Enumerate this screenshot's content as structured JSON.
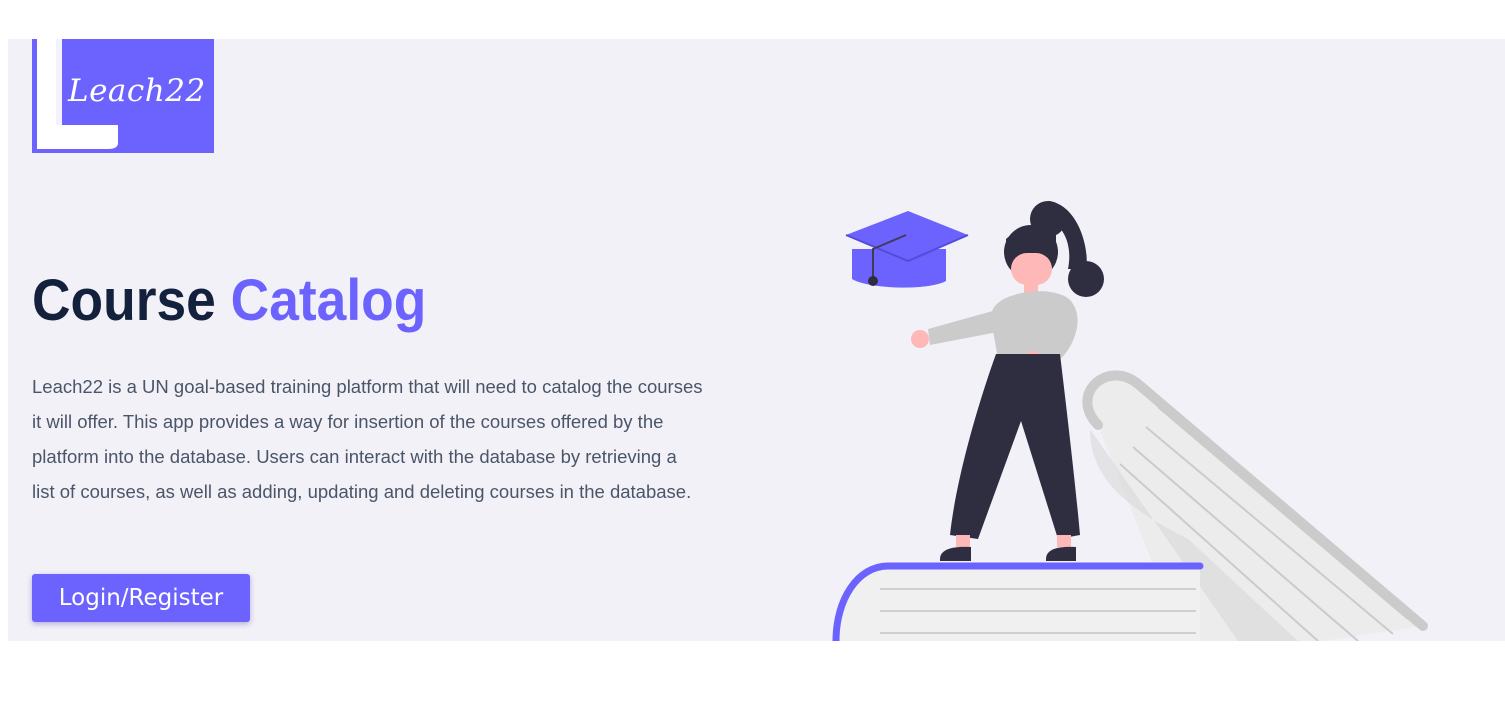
{
  "brand": {
    "logo_text": "Leach22",
    "logo_color": "#6c63ff"
  },
  "hero": {
    "title_main": "Course",
    "title_accent": "Catalog",
    "description": "Leach22 is a UN goal-based training platform that will need to catalog the courses it will offer. This app provides a way for insertion of the courses offered by the platform into the database. Users can interact with the database by retrieving a list of courses, as well as adding, updating and deleting courses in the database.",
    "cta_label": "Login/Register"
  },
  "illustration": {
    "icon": "student-on-books-illustration",
    "accent_color": "#6c63ff"
  },
  "colors": {
    "accent": "#6c63ff",
    "heading": "#14213d",
    "body_text": "#4a5568",
    "hero_background": "#f2f1f8"
  }
}
